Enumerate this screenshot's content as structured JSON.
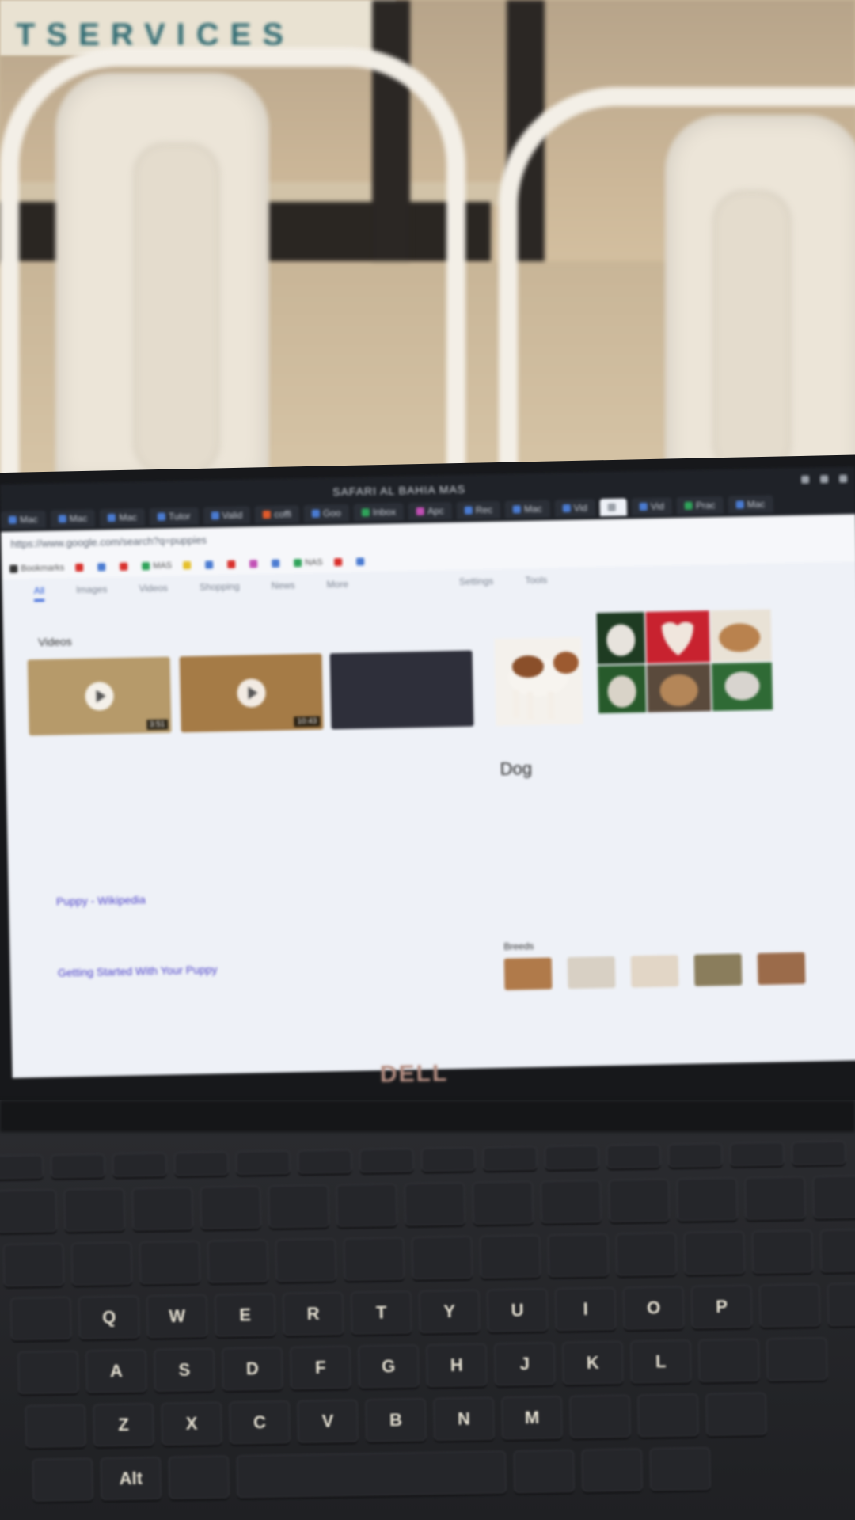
{
  "background": {
    "banner_text": "TSERVICES"
  },
  "browser": {
    "window_title": "SAFARI AL BAHIA MAS",
    "tabs": [
      {
        "label": "Mac",
        "color": "#4a7bd1"
      },
      {
        "label": "Mac",
        "color": "#4a7bd1"
      },
      {
        "label": "Mac",
        "color": "#4a7bd1"
      },
      {
        "label": "Tutor",
        "color": "#4a7bd1"
      },
      {
        "label": "Valid",
        "color": "#4a7bd1"
      },
      {
        "label": "coffi",
        "color": "#e05a2b"
      },
      {
        "label": "Goo",
        "color": "#4a7bd1"
      },
      {
        "label": "Inbox",
        "color": "#2fa35a"
      },
      {
        "label": "Apc",
        "color": "#c24fb5"
      },
      {
        "label": "Rec",
        "color": "#4a7bd1"
      },
      {
        "label": "Mac",
        "color": "#4a7bd1"
      },
      {
        "label": "Vid",
        "color": "#4a7bd1"
      },
      {
        "label": "",
        "color": "#9aa0a8",
        "active": true
      },
      {
        "label": "Vid",
        "color": "#4a7bd1"
      },
      {
        "label": "Prac",
        "color": "#2fa35a"
      },
      {
        "label": "Mac",
        "color": "#4a7bd1"
      }
    ],
    "url": "https://www.google.com/search?q=puppies",
    "bookmarks": [
      {
        "label": "Bookmarks",
        "color": "#333"
      },
      {
        "label": "",
        "color": "#d9302c"
      },
      {
        "label": "",
        "color": "#4a7bd1"
      },
      {
        "label": "",
        "color": "#d9302c"
      },
      {
        "label": "MAS",
        "color": "#2fa35a"
      },
      {
        "label": "",
        "color": "#e5c02a"
      },
      {
        "label": "",
        "color": "#4a7bd1"
      },
      {
        "label": "",
        "color": "#d9302c"
      },
      {
        "label": "",
        "color": "#c24fb5"
      },
      {
        "label": "",
        "color": "#4a7bd1"
      },
      {
        "label": "NAS",
        "color": "#2fa35a"
      },
      {
        "label": "",
        "color": "#d9302c"
      },
      {
        "label": "",
        "color": "#4a7bd1"
      }
    ]
  },
  "search": {
    "tabs": [
      "All",
      "Images",
      "Videos",
      "Shopping",
      "News",
      "More",
      "Settings",
      "Tools"
    ],
    "stats": "",
    "videos_heading": "Videos",
    "videos": [
      {
        "title": "",
        "duration": "3:51",
        "meta": "",
        "thumb": "#b69a6a"
      },
      {
        "title": "",
        "duration": "10:43",
        "meta": "",
        "thumb": "#a57b46"
      },
      {
        "title": "",
        "duration": "",
        "meta": "",
        "thumb": "#2e2f3a"
      }
    ],
    "knowledge_panel": {
      "title": "Dog",
      "subtitle": "",
      "description": "",
      "facts": [],
      "breeds_heading": "Breeds",
      "breed_colors": [
        "#b07a4a",
        "#d8d0c4",
        "#e2d6c6",
        "#8a7d5c",
        "#9b6b4a"
      ]
    },
    "results": [
      {
        "title": "Puppy - Wikipedia",
        "snippet": ""
      },
      {
        "title": "Getting Started With Your Puppy",
        "snippet": ""
      }
    ]
  },
  "laptop": {
    "brand": "DELL"
  },
  "keyboard": {
    "rows": [
      [
        "",
        "",
        "",
        "",
        "",
        "",
        "",
        "",
        "",
        "",
        "",
        "",
        "",
        ""
      ],
      [
        "",
        "",
        "",
        "",
        "",
        "",
        "",
        "",
        "",
        "",
        "",
        "",
        "",
        ""
      ],
      [
        "",
        "",
        "",
        "",
        "",
        "",
        "",
        "",
        "",
        "",
        "",
        "",
        ""
      ],
      [
        "",
        "Q",
        "W",
        "E",
        "R",
        "T",
        "Y",
        "U",
        "I",
        "O",
        "P",
        "",
        ""
      ],
      [
        "",
        "A",
        "S",
        "D",
        "F",
        "G",
        "H",
        "J",
        "K",
        "L",
        "",
        ""
      ],
      [
        "",
        "Z",
        "X",
        "C",
        "V",
        "B",
        "N",
        "M",
        "",
        "",
        ""
      ],
      [
        "",
        "Alt",
        "",
        "",
        "",
        "",
        ""
      ]
    ]
  },
  "colors": {
    "link": "#4a3fc7",
    "accent": "#2a5bd7",
    "bezel": "#17181b",
    "key": "#25262a"
  }
}
